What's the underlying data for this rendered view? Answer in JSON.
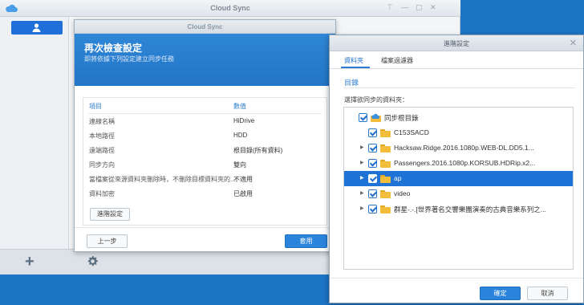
{
  "app": {
    "title": "Cloud Sync"
  },
  "left_panel": {
    "user_tab_icon": "user-icon"
  },
  "bottom_bar": {
    "add_icon": "plus-icon",
    "settings_icon": "gear-icon"
  },
  "review_dialog": {
    "title": "Cloud Sync",
    "heading": "再次檢查設定",
    "subheading": "即將依據下列設定建立同步任務",
    "columns": {
      "item": "項目",
      "value": "數值"
    },
    "rows": [
      {
        "key": "連線名稱",
        "value": "HiDrive"
      },
      {
        "key": "本地路徑",
        "value": "HDD"
      },
      {
        "key": "遠端路徑",
        "value": "根目錄(所有資料)"
      },
      {
        "key": "同步方向",
        "value": "雙向"
      },
      {
        "key": "當檔案從來源資料夾刪除時，不刪除目標資料夾的...",
        "value": "不適用"
      },
      {
        "key": "資料加密",
        "value": "已啟用"
      }
    ],
    "advanced_button": "進階設定",
    "prev_button": "上一步",
    "apply_button": "套用"
  },
  "advanced_dialog": {
    "title": "進階設定",
    "tabs": [
      {
        "label": "資料夾",
        "active": true
      },
      {
        "label": "檔案過濾器",
        "active": false
      }
    ],
    "section_title": "目錄",
    "select_label": "選擇欲同步的資料夾：",
    "tree": [
      {
        "label": "同步根目錄",
        "level": 0,
        "expander": "",
        "icon": "cloud-folder-icon",
        "checked": true,
        "selected": false
      },
      {
        "label": "C153SACD",
        "level": 1,
        "expander": "",
        "icon": "folder-icon",
        "checked": true,
        "selected": false
      },
      {
        "label": "Hacksaw.Ridge.2016.1080p.WEB-DL.DD5.1...",
        "level": 1,
        "expander": "▶",
        "icon": "folder-icon",
        "checked": true,
        "selected": false
      },
      {
        "label": "Passengers.2016.1080p.KORSUB.HDRip.x2...",
        "level": 1,
        "expander": "▶",
        "icon": "folder-icon",
        "checked": true,
        "selected": false
      },
      {
        "label": "ap",
        "level": 1,
        "expander": "▶",
        "icon": "folder-icon",
        "checked": true,
        "selected": true
      },
      {
        "label": "video",
        "level": 1,
        "expander": "▶",
        "icon": "folder-icon",
        "checked": true,
        "selected": false
      },
      {
        "label": "群星-.-.[世界著名交響樂團演奏的古典音樂系列之...",
        "level": 1,
        "expander": "▶",
        "icon": "folder-icon",
        "checked": true,
        "selected": false
      }
    ],
    "ok_button": "確定",
    "cancel_button": "取消"
  }
}
